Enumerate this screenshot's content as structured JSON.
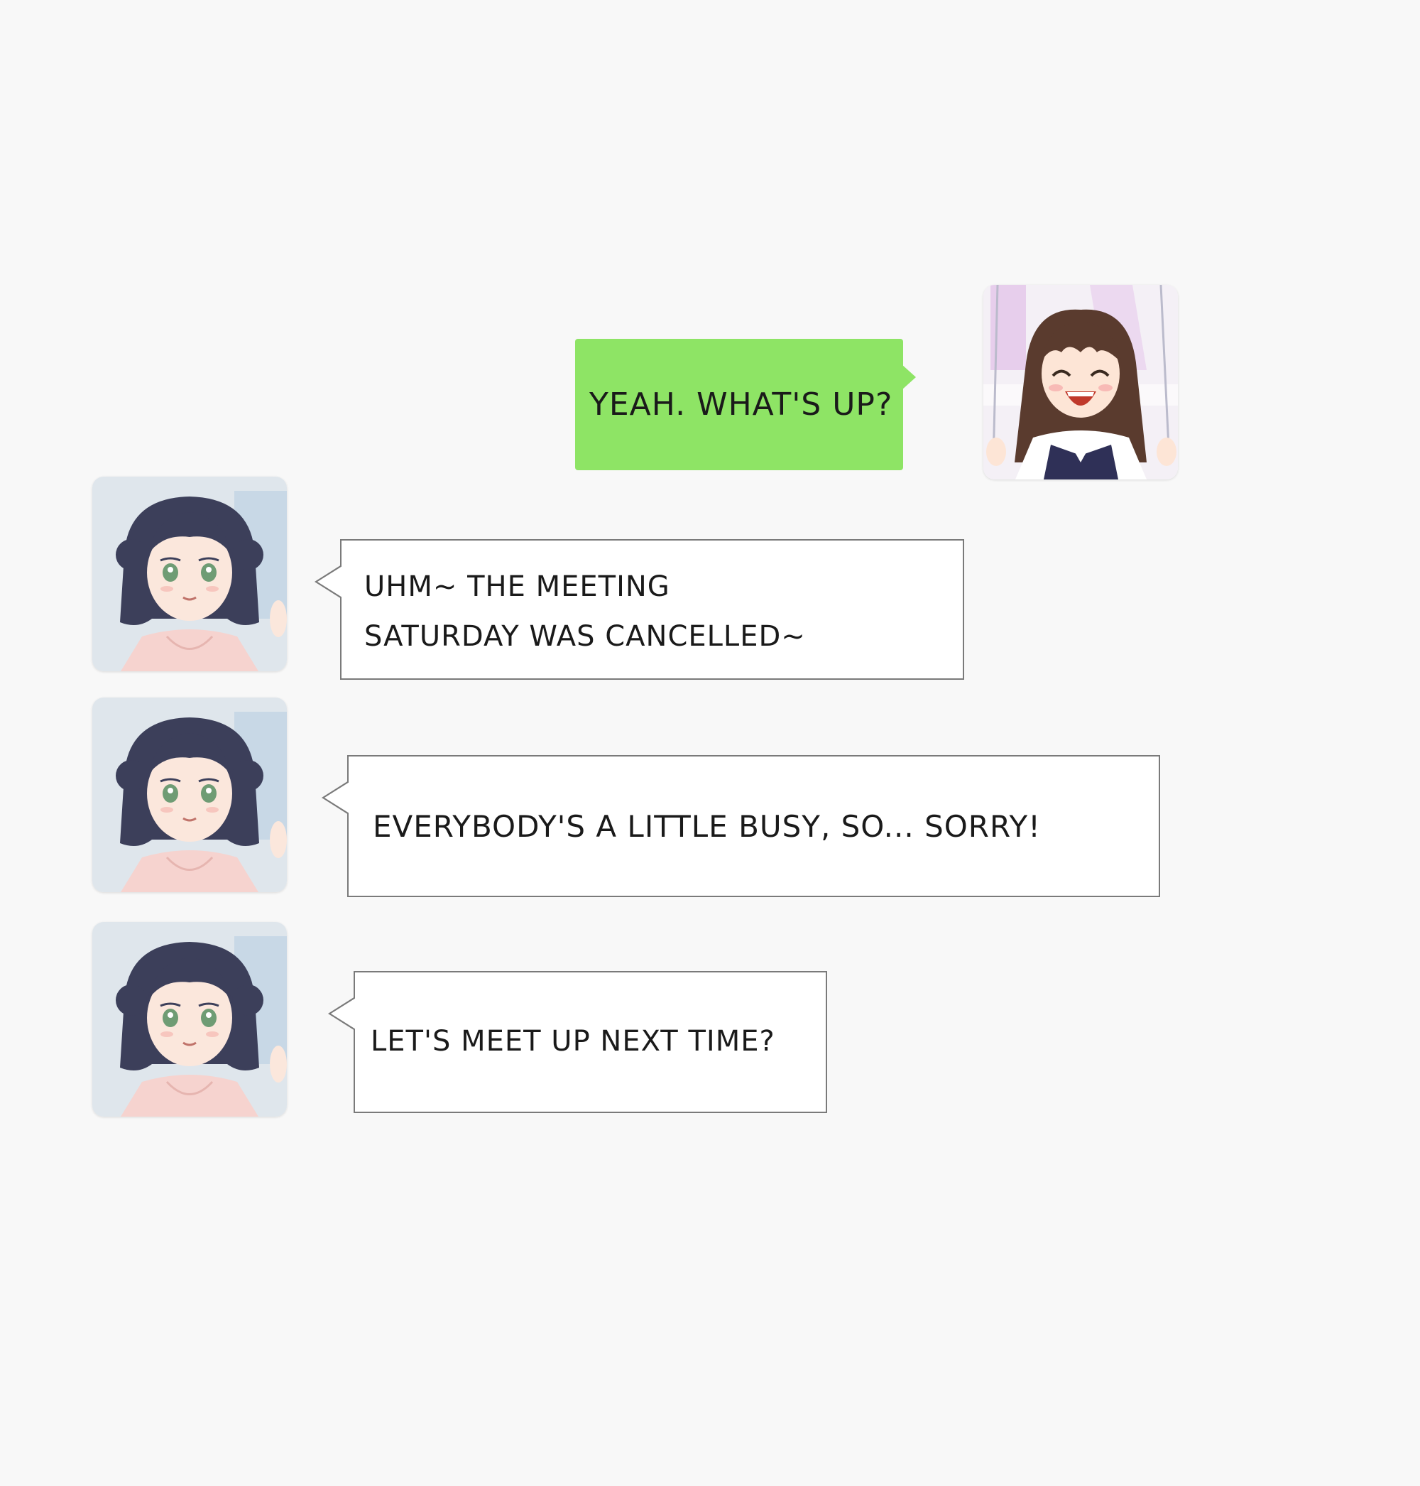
{
  "messages": [
    {
      "sender": "me",
      "text": "YEAH. WHAT'S UP?"
    },
    {
      "sender": "friend",
      "lines": [
        "UHM~ THE MEETING",
        "SATURDAY WAS CANCELLED~"
      ]
    },
    {
      "sender": "friend",
      "text": "EVERYBODY'S A LITTLE BUSY, SO... SORRY!"
    },
    {
      "sender": "friend",
      "text": "LET'S MEET UP NEXT TIME?"
    }
  ],
  "avatars": {
    "me": "laughing-girl-avatar",
    "friend": "dark-haired-girl-avatar"
  },
  "colors": {
    "background": "#f8f8f8",
    "sent_bubble": "#8ee465",
    "received_bubble": "#ffffff",
    "bubble_border": "#7a7a7a"
  }
}
